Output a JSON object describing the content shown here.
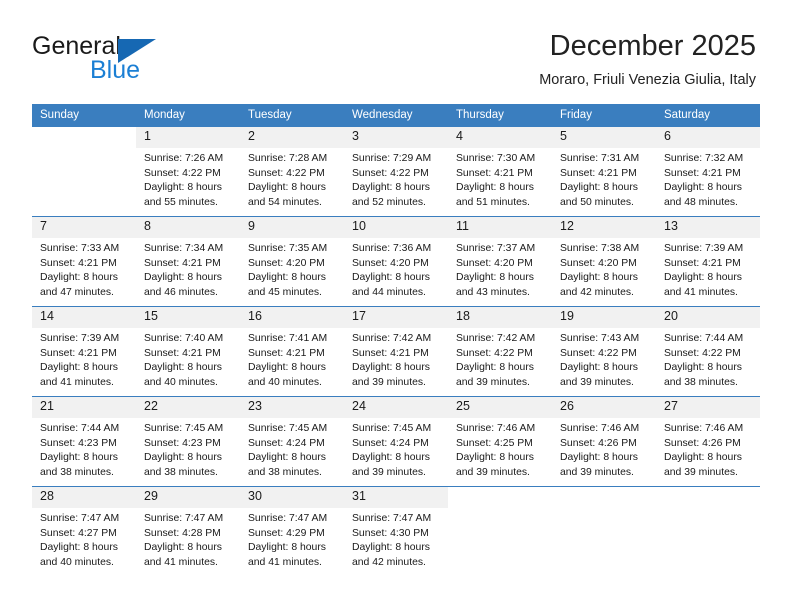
{
  "brand": {
    "name_part1": "General",
    "name_part2": "Blue",
    "logo_icon": "blue-triangle-logo"
  },
  "header": {
    "title": "December 2025",
    "subtitle": "Moraro, Friuli Venezia Giulia, Italy"
  },
  "colors": {
    "header_blue": "#3a7ebf",
    "brand_blue": "#1b7fd4",
    "logo_blue": "#1668b3",
    "daynum_bg": "#f1f1f1"
  },
  "weekdays": [
    "Sunday",
    "Monday",
    "Tuesday",
    "Wednesday",
    "Thursday",
    "Friday",
    "Saturday"
  ],
  "weeks": [
    [
      {
        "day": "",
        "sunrise": "",
        "sunset": "",
        "daylight1": "",
        "daylight2": ""
      },
      {
        "day": "1",
        "sunrise": "Sunrise: 7:26 AM",
        "sunset": "Sunset: 4:22 PM",
        "daylight1": "Daylight: 8 hours",
        "daylight2": "and 55 minutes."
      },
      {
        "day": "2",
        "sunrise": "Sunrise: 7:28 AM",
        "sunset": "Sunset: 4:22 PM",
        "daylight1": "Daylight: 8 hours",
        "daylight2": "and 54 minutes."
      },
      {
        "day": "3",
        "sunrise": "Sunrise: 7:29 AM",
        "sunset": "Sunset: 4:22 PM",
        "daylight1": "Daylight: 8 hours",
        "daylight2": "and 52 minutes."
      },
      {
        "day": "4",
        "sunrise": "Sunrise: 7:30 AM",
        "sunset": "Sunset: 4:21 PM",
        "daylight1": "Daylight: 8 hours",
        "daylight2": "and 51 minutes."
      },
      {
        "day": "5",
        "sunrise": "Sunrise: 7:31 AM",
        "sunset": "Sunset: 4:21 PM",
        "daylight1": "Daylight: 8 hours",
        "daylight2": "and 50 minutes."
      },
      {
        "day": "6",
        "sunrise": "Sunrise: 7:32 AM",
        "sunset": "Sunset: 4:21 PM",
        "daylight1": "Daylight: 8 hours",
        "daylight2": "and 48 minutes."
      }
    ],
    [
      {
        "day": "7",
        "sunrise": "Sunrise: 7:33 AM",
        "sunset": "Sunset: 4:21 PM",
        "daylight1": "Daylight: 8 hours",
        "daylight2": "and 47 minutes."
      },
      {
        "day": "8",
        "sunrise": "Sunrise: 7:34 AM",
        "sunset": "Sunset: 4:21 PM",
        "daylight1": "Daylight: 8 hours",
        "daylight2": "and 46 minutes."
      },
      {
        "day": "9",
        "sunrise": "Sunrise: 7:35 AM",
        "sunset": "Sunset: 4:20 PM",
        "daylight1": "Daylight: 8 hours",
        "daylight2": "and 45 minutes."
      },
      {
        "day": "10",
        "sunrise": "Sunrise: 7:36 AM",
        "sunset": "Sunset: 4:20 PM",
        "daylight1": "Daylight: 8 hours",
        "daylight2": "and 44 minutes."
      },
      {
        "day": "11",
        "sunrise": "Sunrise: 7:37 AM",
        "sunset": "Sunset: 4:20 PM",
        "daylight1": "Daylight: 8 hours",
        "daylight2": "and 43 minutes."
      },
      {
        "day": "12",
        "sunrise": "Sunrise: 7:38 AM",
        "sunset": "Sunset: 4:20 PM",
        "daylight1": "Daylight: 8 hours",
        "daylight2": "and 42 minutes."
      },
      {
        "day": "13",
        "sunrise": "Sunrise: 7:39 AM",
        "sunset": "Sunset: 4:21 PM",
        "daylight1": "Daylight: 8 hours",
        "daylight2": "and 41 minutes."
      }
    ],
    [
      {
        "day": "14",
        "sunrise": "Sunrise: 7:39 AM",
        "sunset": "Sunset: 4:21 PM",
        "daylight1": "Daylight: 8 hours",
        "daylight2": "and 41 minutes."
      },
      {
        "day": "15",
        "sunrise": "Sunrise: 7:40 AM",
        "sunset": "Sunset: 4:21 PM",
        "daylight1": "Daylight: 8 hours",
        "daylight2": "and 40 minutes."
      },
      {
        "day": "16",
        "sunrise": "Sunrise: 7:41 AM",
        "sunset": "Sunset: 4:21 PM",
        "daylight1": "Daylight: 8 hours",
        "daylight2": "and 40 minutes."
      },
      {
        "day": "17",
        "sunrise": "Sunrise: 7:42 AM",
        "sunset": "Sunset: 4:21 PM",
        "daylight1": "Daylight: 8 hours",
        "daylight2": "and 39 minutes."
      },
      {
        "day": "18",
        "sunrise": "Sunrise: 7:42 AM",
        "sunset": "Sunset: 4:22 PM",
        "daylight1": "Daylight: 8 hours",
        "daylight2": "and 39 minutes."
      },
      {
        "day": "19",
        "sunrise": "Sunrise: 7:43 AM",
        "sunset": "Sunset: 4:22 PM",
        "daylight1": "Daylight: 8 hours",
        "daylight2": "and 39 minutes."
      },
      {
        "day": "20",
        "sunrise": "Sunrise: 7:44 AM",
        "sunset": "Sunset: 4:22 PM",
        "daylight1": "Daylight: 8 hours",
        "daylight2": "and 38 minutes."
      }
    ],
    [
      {
        "day": "21",
        "sunrise": "Sunrise: 7:44 AM",
        "sunset": "Sunset: 4:23 PM",
        "daylight1": "Daylight: 8 hours",
        "daylight2": "and 38 minutes."
      },
      {
        "day": "22",
        "sunrise": "Sunrise: 7:45 AM",
        "sunset": "Sunset: 4:23 PM",
        "daylight1": "Daylight: 8 hours",
        "daylight2": "and 38 minutes."
      },
      {
        "day": "23",
        "sunrise": "Sunrise: 7:45 AM",
        "sunset": "Sunset: 4:24 PM",
        "daylight1": "Daylight: 8 hours",
        "daylight2": "and 38 minutes."
      },
      {
        "day": "24",
        "sunrise": "Sunrise: 7:45 AM",
        "sunset": "Sunset: 4:24 PM",
        "daylight1": "Daylight: 8 hours",
        "daylight2": "and 39 minutes."
      },
      {
        "day": "25",
        "sunrise": "Sunrise: 7:46 AM",
        "sunset": "Sunset: 4:25 PM",
        "daylight1": "Daylight: 8 hours",
        "daylight2": "and 39 minutes."
      },
      {
        "day": "26",
        "sunrise": "Sunrise: 7:46 AM",
        "sunset": "Sunset: 4:26 PM",
        "daylight1": "Daylight: 8 hours",
        "daylight2": "and 39 minutes."
      },
      {
        "day": "27",
        "sunrise": "Sunrise: 7:46 AM",
        "sunset": "Sunset: 4:26 PM",
        "daylight1": "Daylight: 8 hours",
        "daylight2": "and 39 minutes."
      }
    ],
    [
      {
        "day": "28",
        "sunrise": "Sunrise: 7:47 AM",
        "sunset": "Sunset: 4:27 PM",
        "daylight1": "Daylight: 8 hours",
        "daylight2": "and 40 minutes."
      },
      {
        "day": "29",
        "sunrise": "Sunrise: 7:47 AM",
        "sunset": "Sunset: 4:28 PM",
        "daylight1": "Daylight: 8 hours",
        "daylight2": "and 41 minutes."
      },
      {
        "day": "30",
        "sunrise": "Sunrise: 7:47 AM",
        "sunset": "Sunset: 4:29 PM",
        "daylight1": "Daylight: 8 hours",
        "daylight2": "and 41 minutes."
      },
      {
        "day": "31",
        "sunrise": "Sunrise: 7:47 AM",
        "sunset": "Sunset: 4:30 PM",
        "daylight1": "Daylight: 8 hours",
        "daylight2": "and 42 minutes."
      },
      {
        "day": "",
        "sunrise": "",
        "sunset": "",
        "daylight1": "",
        "daylight2": ""
      },
      {
        "day": "",
        "sunrise": "",
        "sunset": "",
        "daylight1": "",
        "daylight2": ""
      },
      {
        "day": "",
        "sunrise": "",
        "sunset": "",
        "daylight1": "",
        "daylight2": ""
      }
    ]
  ]
}
